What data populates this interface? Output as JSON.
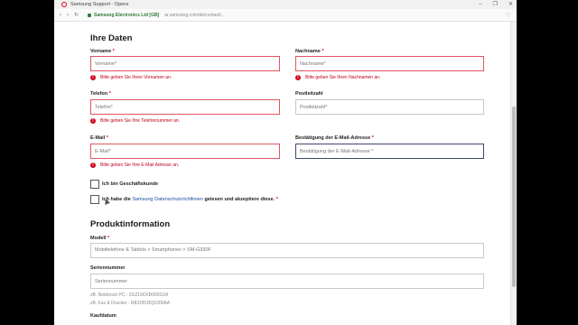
{
  "browser": {
    "title": "Samsung Support - Opera",
    "site_identity": "Samsung Electronics Ltd [GB]",
    "url": "ar.samsung.com/de/contact/..."
  },
  "form": {
    "section_personal": "Ihre Daten",
    "vorname": {
      "label": "Vorname",
      "placeholder": "Vorname*",
      "error": "Bitte geben Sie Ihren Vornamen an."
    },
    "nachname": {
      "label": "Nachname",
      "placeholder": "Nachname*",
      "error": "Bitte geben Sie Ihren Nachnamen an."
    },
    "telefon": {
      "label": "Telefon",
      "placeholder": "Telefon*",
      "error": "Bitte geben Sie Ihre Telefonnummer an."
    },
    "postleitzahl": {
      "label": "Postleitzahl",
      "placeholder": "Postleitzahl*"
    },
    "email": {
      "label": "E-Mail",
      "placeholder": "E-Mail*",
      "error": "Bitte geben Sie Ihre E-Mail Adresse an."
    },
    "email_confirm": {
      "label": "Bestätigung der E-Mail-Adresse",
      "placeholder": "Bestätigung der E-Mail-Adresse *"
    },
    "business_customer": "Ich bin Geschäftskunde",
    "privacy_prefix": "Ich habe die",
    "privacy_link": "Samsung Datenschutzrichtlinien",
    "privacy_suffix": "gelesen und akzeptiere diese.",
    "required_mark": "*",
    "section_product": "Produktinformation",
    "modell": {
      "label": "Modell",
      "value": "Mobiltelefone & Tablets > Smartphones > SM-G930F"
    },
    "seriennummer": {
      "label": "Seriennummer",
      "placeholder": "Seriennummer"
    },
    "hint_1": "zB. Notebook PC - 2G219CKB00031M",
    "hint_2": "zB. Fax & Drucker - R831B1BQ1000AA",
    "kaufdatum": {
      "label": "Kaufdatum"
    }
  },
  "colors": {
    "error": "#e0001b",
    "link": "#1a4fa0",
    "focus_border": "#3c4a6b"
  }
}
